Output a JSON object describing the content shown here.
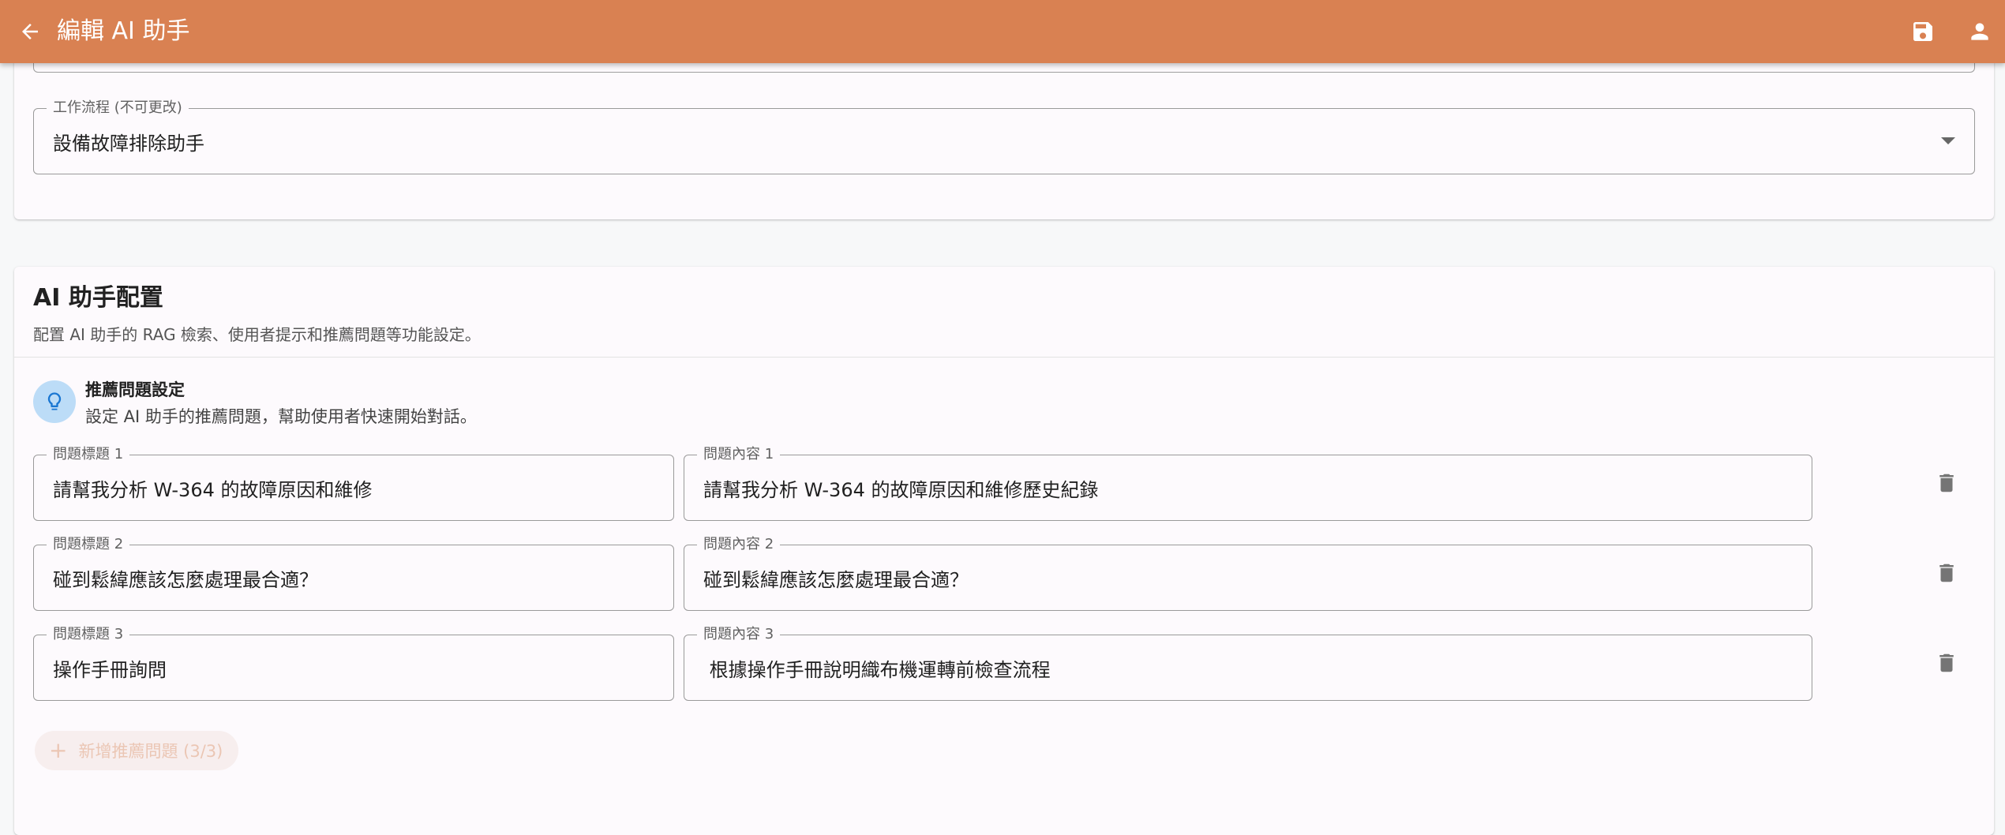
{
  "appbar": {
    "title": "編輯 AI 助手",
    "back_icon": "arrow-left-icon",
    "save_icon": "save-icon",
    "account_icon": "account-icon",
    "color": "#d98152"
  },
  "workflow": {
    "label": "工作流程 (不可更改)",
    "value": "設備故障排除助手"
  },
  "config": {
    "title": "AI 助手配置",
    "subtitle": "配置 AI 助手的 RAG 檢索、使用者提示和推薦問題等功能設定。"
  },
  "suggested": {
    "icon": "lightbulb-icon",
    "title": "推薦問題設定",
    "subtitle": "設定 AI 助手的推薦問題，幫助使用者快速開始對話。",
    "questions": [
      {
        "title_label": "問題標題 1",
        "title_value": "請幫我分析 W-364 的故障原因和維修",
        "content_label": "問題內容 1",
        "content_value": "請幫我分析 W-364 的故障原因和維修歷史紀錄"
      },
      {
        "title_label": "問題標題 2",
        "title_value": "碰到鬆緯應該怎麼處理最合適？",
        "content_label": "問題內容 2",
        "content_value": "碰到鬆緯應該怎麼處理最合適？"
      },
      {
        "title_label": "問題標題 3",
        "title_value": "操作手冊詢問",
        "content_label": "問題內容 3",
        "content_value": " 根據操作手冊說明織布機運轉前檢查流程"
      }
    ],
    "add_button": "新增推薦問題 (3/3)"
  }
}
